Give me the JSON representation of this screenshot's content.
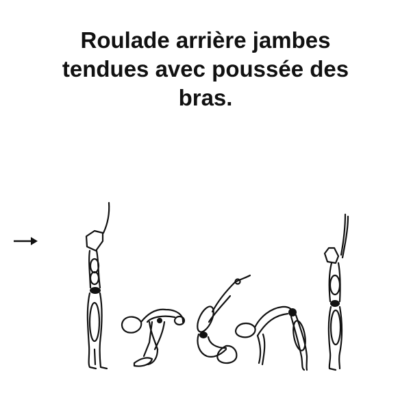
{
  "title_lines": [
    "Roulade arrière jambes",
    "tendues avec poussée des",
    "bras."
  ],
  "diagram": {
    "direction_arrow_icon": "arrow-right-icon",
    "phases": [
      "standing-arms-up",
      "squat-to-back",
      "rolling-on-back",
      "push-through-hands",
      "pike-to-feet",
      "standing-finish-arms-up"
    ]
  }
}
